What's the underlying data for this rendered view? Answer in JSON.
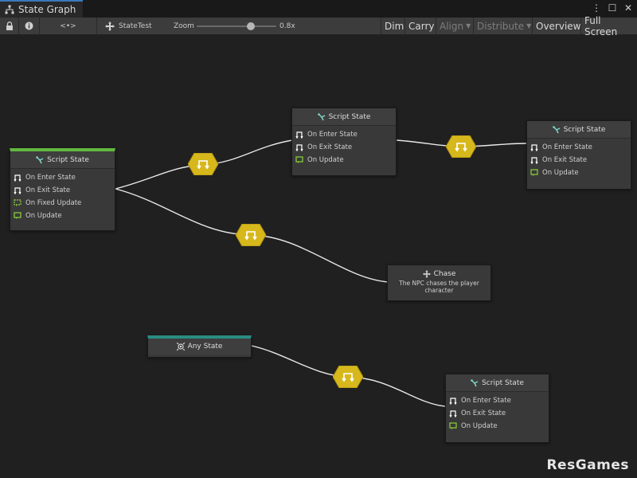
{
  "window": {
    "tab_title": "State Graph",
    "controls": {
      "menu": "⋮",
      "maximize": "☐",
      "close": "✕"
    }
  },
  "toolbar": {
    "nav_symbol": "<•>",
    "graph_name": "StateTest",
    "zoom_label": "Zoom",
    "zoom_value": "0.8x",
    "zoom_level": 0.8,
    "dim": "Dim",
    "carry": "Carry",
    "align": "Align",
    "distribute": "Distribute",
    "overview": "Overview",
    "full_screen": "Full Screen"
  },
  "nodes": {
    "start": {
      "title": "Script State",
      "rows": [
        "On Enter State",
        "On Exit State",
        "On Fixed Update",
        "On Update"
      ],
      "accent": "#62b840"
    },
    "top_middle": {
      "title": "Script State",
      "rows": [
        "On Enter State",
        "On Exit State",
        "On Update"
      ]
    },
    "top_right": {
      "title": "Script State",
      "rows": [
        "On Enter State",
        "On Exit State",
        "On Update"
      ]
    },
    "chase": {
      "title": "Chase",
      "description": "The NPC chases the player character"
    },
    "any_state": {
      "title": "Any State",
      "accent": "#2a8c82"
    },
    "bottom_right": {
      "title": "Script State",
      "rows": [
        "On Enter State",
        "On Exit State",
        "On Update"
      ]
    }
  },
  "colors": {
    "transition": "#d7b81c",
    "event_icon_green": "#8bd43a",
    "wire": "#e8e8e8"
  },
  "watermark": "ResGames"
}
